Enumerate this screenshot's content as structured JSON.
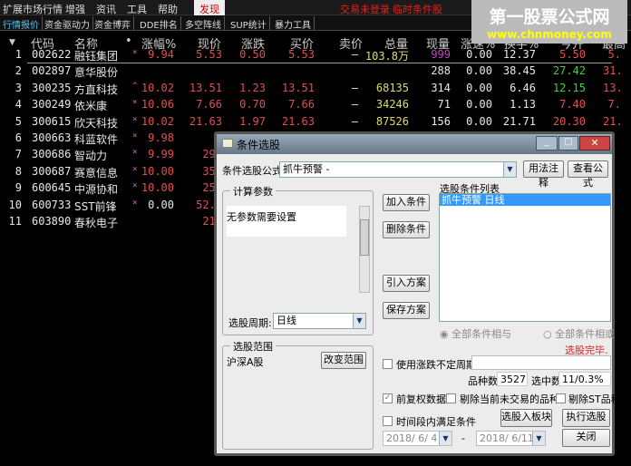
{
  "menu": {
    "items": [
      "扩展市场行情",
      "增强",
      "资讯",
      "工具",
      "帮助"
    ],
    "active": "发现",
    "status1": "交易未登录",
    "status2": "临时条件股"
  },
  "tabs": [
    "行情报价",
    "资金驱动力",
    "资金博弈",
    "DDE排名",
    "多空阵线",
    "SUP统计",
    "暴力工具"
  ],
  "watermark": {
    "title": "第一股票公式网",
    "url": "www.chnmoney.com"
  },
  "table": {
    "headers": [
      "代码",
      "名称",
      "•",
      "涨幅%",
      "现价",
      "涨跌",
      "买价",
      "卖价",
      "总量",
      "现量",
      "涨速%",
      "换手%",
      "今开",
      "最高"
    ],
    "rows": [
      {
        "i": "1",
        "code": "002622",
        "name": "融钰集团",
        "mark": "×",
        "pct": "9.94",
        "price": "5.53",
        "chg": "0.50",
        "bid": "5.53",
        "ask": "—",
        "vol": "103.8万",
        "cur": "999",
        "spd": "0.00",
        "turn": "12.37",
        "open": "5.50",
        "high": "5."
      },
      {
        "i": "2",
        "code": "002897",
        "name": "意华股份",
        "mark": "",
        "pct": "",
        "price": "",
        "chg": "",
        "bid": "",
        "ask": "",
        "vol": "",
        "cur": "288",
        "spd": "0.00",
        "turn": "38.45",
        "open": "27.42",
        "high": "31."
      },
      {
        "i": "3",
        "code": "300235",
        "name": "方直科技",
        "mark": "^",
        "pct": "10.02",
        "price": "13.51",
        "chg": "1.23",
        "bid": "13.51",
        "ask": "—",
        "vol": "68135",
        "cur": "314",
        "spd": "0.00",
        "turn": "6.46",
        "open": "12.15",
        "high": "13."
      },
      {
        "i": "4",
        "code": "300249",
        "name": "依米康",
        "mark": "×",
        "pct": "10.06",
        "price": "7.66",
        "chg": "0.70",
        "bid": "7.66",
        "ask": "—",
        "vol": "34246",
        "cur": "71",
        "spd": "0.00",
        "turn": "1.13",
        "open": "7.40",
        "high": "7."
      },
      {
        "i": "5",
        "code": "300615",
        "name": "欣天科技",
        "mark": "×",
        "pct": "10.02",
        "price": "21.63",
        "chg": "1.97",
        "bid": "21.63",
        "ask": "—",
        "vol": "87526",
        "cur": "156",
        "spd": "0.00",
        "turn": "21.71",
        "open": "20.30",
        "high": "21."
      },
      {
        "i": "6",
        "code": "300663",
        "name": "科蓝软件",
        "mark": "×",
        "pct": "9.98",
        "price": ""
      },
      {
        "i": "7",
        "code": "300686",
        "name": "智动力",
        "mark": "×",
        "pct": "9.99",
        "price": "29."
      },
      {
        "i": "8",
        "code": "300687",
        "name": "赛意信息",
        "mark": "×",
        "pct": "10.00",
        "price": "35."
      },
      {
        "i": "9",
        "code": "600645",
        "name": "中源协和",
        "mark": "×",
        "pct": "10.00",
        "price": "25."
      },
      {
        "i": "10",
        "code": "600733",
        "name": "SST前锋",
        "mark": "×",
        "pct": "0.00",
        "price": "52.0"
      },
      {
        "i": "11",
        "code": "603890",
        "name": "春秋电子",
        "mark": "",
        "pct": "",
        "price": "21."
      }
    ]
  },
  "dialog": {
    "title": "条件选股",
    "formula_label": "条件选股公式",
    "formula_value": "抓牛预警        -",
    "usage_btn": "用法注释",
    "view_btn": "查看公式",
    "params_group": "计算参数",
    "params_text": "无参数需要设置",
    "period_label": "选股周期:",
    "period_value": "日线",
    "add_btn": "加入条件",
    "del_btn": "删除条件",
    "import_btn": "引入方案",
    "save_btn": "保存方案",
    "list_label": "选股条件列表",
    "list_items": [
      "抓牛预警   日线"
    ],
    "radio_and": "全部条件相与",
    "radio_or": "全部条件相或",
    "done_text": "选股完毕.",
    "range_group": "选股范围",
    "range_value": "沪深A股",
    "range_btn": "改变范围",
    "use_period": "使用涨跌不定周期",
    "count_label": "品种数",
    "count_value": "3527",
    "sel_label": "选中数",
    "sel_value": "11/0.3%",
    "fq": "前复权数据",
    "exclude_untraded": "剔除当前未交易的品种",
    "exclude_st": "剔除ST品种",
    "time_cond": "时间段内满足条件",
    "to_block_btn": "选股入板块",
    "run_btn": "执行选股",
    "close_btn": "关闭",
    "date_from": "2018/ 6/ 4",
    "date_sep": "-",
    "date_to": "2018/ 6/11"
  }
}
